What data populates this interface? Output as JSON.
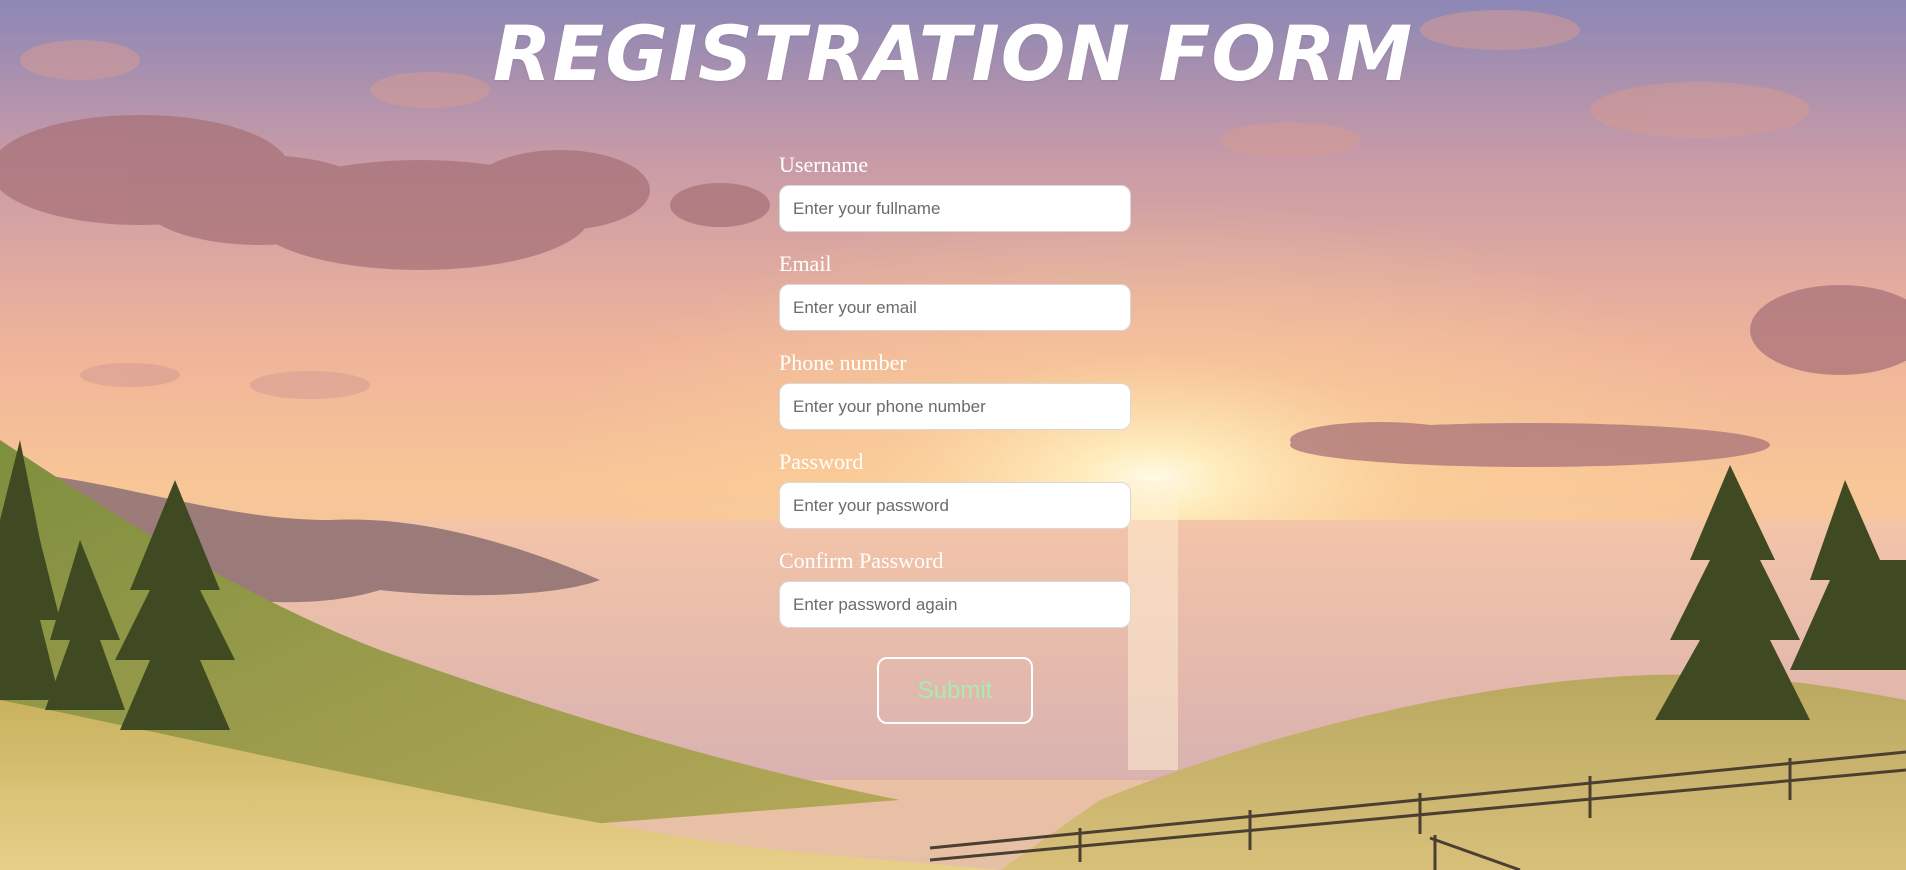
{
  "page": {
    "title": "REGISTRATION FORM"
  },
  "form": {
    "fields": [
      {
        "label": "Username",
        "placeholder": "Enter your fullname",
        "value": ""
      },
      {
        "label": "Email",
        "placeholder": "Enter your email",
        "value": ""
      },
      {
        "label": "Phone number",
        "placeholder": "Enter your phone number",
        "value": ""
      },
      {
        "label": "Password",
        "placeholder": "Enter your password",
        "value": ""
      },
      {
        "label": "Confirm Password",
        "placeholder": "Enter password again",
        "value": ""
      }
    ],
    "submit_label": "Submit"
  },
  "colors": {
    "text": "#ffffff",
    "submit_text": "#a9ecb0",
    "input_background": "#ffffff"
  }
}
